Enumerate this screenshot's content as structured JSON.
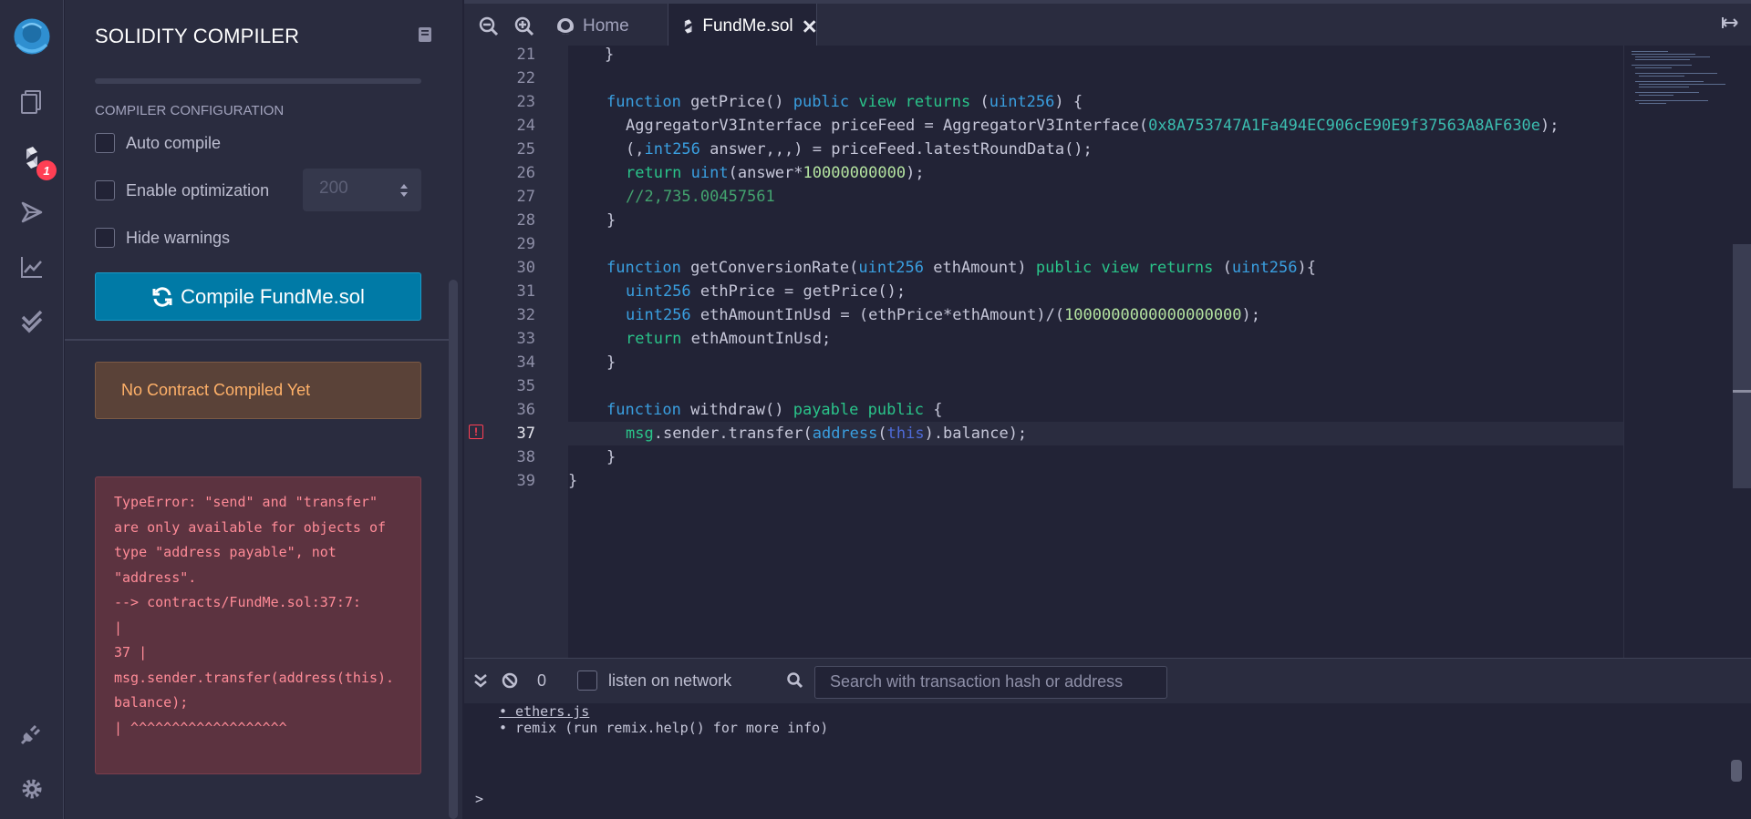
{
  "panel": {
    "title": "SOLIDITY COMPILER",
    "config_heading": "COMPILER CONFIGURATION",
    "auto_compile": "Auto compile",
    "enable_optimization": "Enable optimization",
    "optimization_runs": "200",
    "hide_warnings": "Hide warnings",
    "compile_button": "Compile FundMe.sol",
    "no_contract": "No Contract Compiled Yet",
    "error_lines": [
      "TypeError: \"send\" and \"transfer\"",
      "are only available for objects of",
      "type \"address payable\", not",
      "\"address\".",
      "--> contracts/FundMe.sol:37:7:",
      "|",
      "37 |",
      "msg.sender.transfer(address(this).",
      "balance);",
      "| ^^^^^^^^^^^^^^^^^^^"
    ]
  },
  "rail": {
    "badge": "1"
  },
  "tabs": {
    "home": "Home",
    "active": "FundMe.sol"
  },
  "editor": {
    "line_numbers": [
      "21",
      "22",
      "23",
      "24",
      "25",
      "26",
      "27",
      "28",
      "29",
      "30",
      "31",
      "32",
      "33",
      "34",
      "35",
      "36",
      "37",
      "38",
      "39"
    ]
  },
  "terminal": {
    "count": "0",
    "listen_label": "listen on network",
    "search_placeholder": "Search with transaction hash or address",
    "lines": [
      "• ethers.js",
      "• remix (run remix.help() for more info)"
    ],
    "prompt": ">"
  },
  "colors": {
    "accent": "#007aa6",
    "keyword": "#2ac48a",
    "type": "#3a9fe0",
    "error": "#ff3f54",
    "warning_text": "#ffb169"
  }
}
